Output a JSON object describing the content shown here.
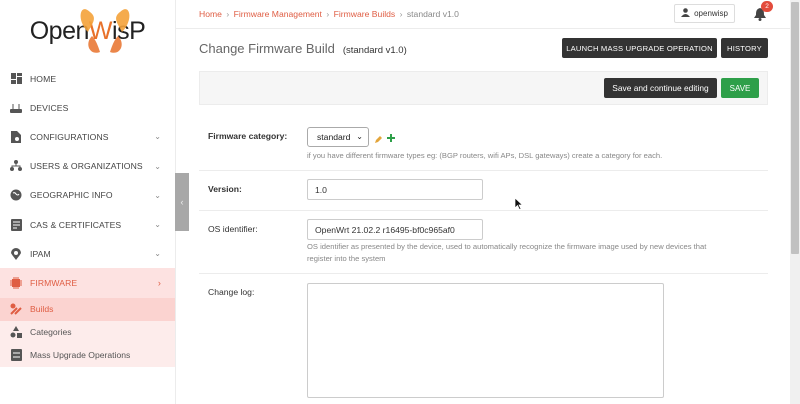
{
  "brand": {
    "logo_text_a": "Open",
    "logo_text_b": "W",
    "logo_text_c": "isP"
  },
  "sidebar": {
    "items": [
      {
        "label": "HOME",
        "icon": "dashboard-icon",
        "chevron": ""
      },
      {
        "label": "DEVICES",
        "icon": "router-icon",
        "chevron": ""
      },
      {
        "label": "CONFIGURATIONS",
        "icon": "file-gear-icon",
        "chevron": "⌄"
      },
      {
        "label": "USERS & ORGANIZATIONS",
        "icon": "org-icon",
        "chevron": "⌄"
      },
      {
        "label": "GEOGRAPHIC INFO",
        "icon": "globe-icon",
        "chevron": "⌄"
      },
      {
        "label": "CAS & CERTIFICATES",
        "icon": "certificate-icon",
        "chevron": "⌄"
      },
      {
        "label": "IPAM",
        "icon": "map-pin-icon",
        "chevron": "⌄"
      },
      {
        "label": "FIRMWARE",
        "icon": "chip-icon",
        "chevron": "›"
      }
    ],
    "subitems": [
      {
        "label": "Builds",
        "icon": "tools-icon"
      },
      {
        "label": "Categories",
        "icon": "shapes-icon"
      },
      {
        "label": "Mass Upgrade Operations",
        "icon": "db-icon"
      }
    ],
    "collapse_glyph": "‹"
  },
  "breadcrumb": {
    "home": "Home",
    "firmware": "Firmware Management",
    "builds": "Firmware Builds",
    "current": "standard v1.0",
    "sep": "›"
  },
  "user": {
    "name": "openwisp",
    "notifications": "2"
  },
  "page": {
    "title": "Change Firmware Build",
    "subtitle": "(standard v1.0)",
    "launch_button": "LAUNCH MASS UPGRADE OPERATION",
    "history_button": "HISTORY",
    "save_continue": "Save and continue editing",
    "save": "SAVE"
  },
  "form": {
    "category_label": "Firmware category:",
    "category_value": "standard",
    "category_help": "if you have different firmware types eg: (BGP routers, wifi APs, DSL gateways) create a category for each.",
    "version_label": "Version:",
    "version_value": "1.0",
    "os_label": "OS identifier:",
    "os_value": "OpenWrt 21.02.2 r16495-bf0c965af0",
    "os_help_1": "OS identifier as presented by the device, used to automatically recognize the firmware image used by new devices that",
    "os_help_2": "register into the system",
    "changelog_label": "Change log:"
  },
  "colors": {
    "accent": "#df5d43",
    "save_green": "#2e9f49",
    "dark_button": "#333333"
  }
}
